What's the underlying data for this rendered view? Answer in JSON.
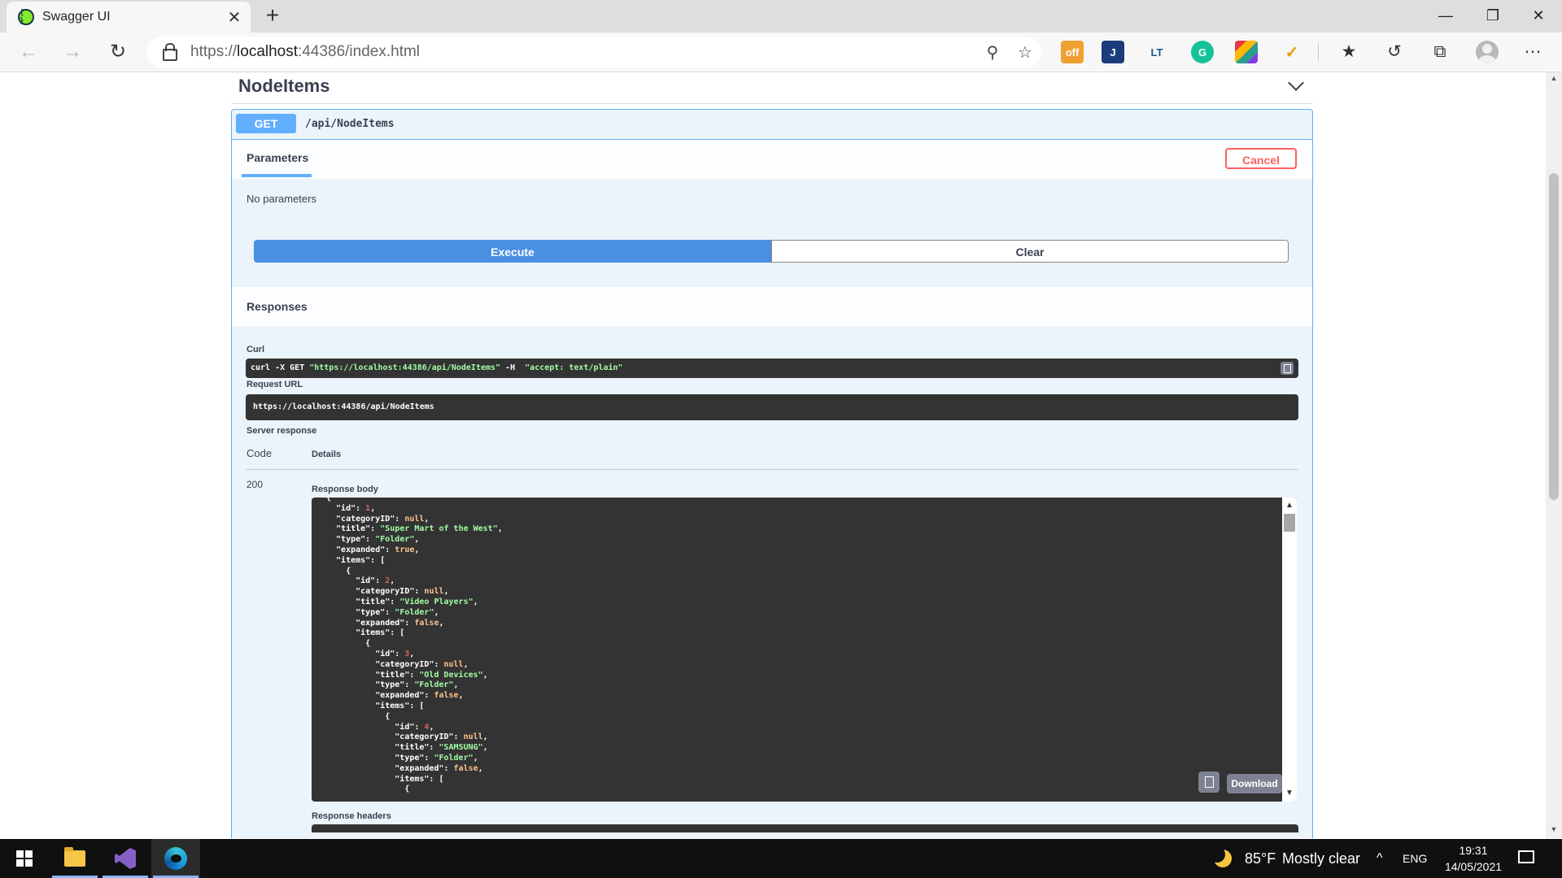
{
  "browser": {
    "tab_title": "Swagger UI",
    "tab_favicon": "swagger-icon",
    "url_scheme": "https://",
    "url_host": "localhost",
    "url_rest": ":44386/index.html",
    "new_tab": "+",
    "close_tab": "✕"
  },
  "section": {
    "name": "NodeItems"
  },
  "operation": {
    "method": "GET",
    "path": "/api/NodeItems",
    "method_color": "#61affe"
  },
  "params": {
    "tab_label": "Parameters",
    "cancel_label": "Cancel",
    "empty_text": "No parameters",
    "execute_label": "Execute",
    "clear_label": "Clear"
  },
  "responses": {
    "title": "Responses",
    "curl_label": "Curl",
    "curl_cmd": "curl -X GET ",
    "curl_url": "\"https://localhost:44386/api/NodeItems\"",
    "curl_h": " -H  ",
    "curl_accept": "\"accept: text/plain\"",
    "request_url_label": "Request URL",
    "request_url": "https://localhost:44386/api/NodeItems",
    "server_response_label": "Server response",
    "code_header": "Code",
    "details_header": "Details",
    "status_code": "200",
    "response_body_label": "Response body",
    "download_label": "Download",
    "response_headers_label": "Response headers"
  },
  "response_body_lines": [
    "{",
    "  \"id\": 1,",
    "  \"categoryID\": null,",
    "  \"title\": \"Super Mart of the West\",",
    "  \"type\": \"Folder\",",
    "  \"expanded\": true,",
    "  \"items\": [",
    "    {",
    "      \"id\": 2,",
    "      \"categoryID\": null,",
    "      \"title\": \"Video Players\",",
    "      \"type\": \"Folder\",",
    "      \"expanded\": false,",
    "      \"items\": [",
    "        {",
    "          \"id\": 3,",
    "          \"categoryID\": null,",
    "          \"title\": \"Old Devices\",",
    "          \"type\": \"Folder\",",
    "          \"expanded\": false,",
    "          \"items\": [",
    "            {",
    "              \"id\": 4,",
    "              \"categoryID\": null,",
    "              \"title\": \"SAMSUNG\",",
    "              \"type\": \"Folder\",",
    "              \"expanded\": false,",
    "              \"items\": [",
    "                {"
  ],
  "taskbar": {
    "weather_temp": "85°F",
    "weather_text": "Mostly clear",
    "language": "ENG",
    "time": "19:31",
    "date": "14/05/2021",
    "tray_chevron": "^"
  }
}
